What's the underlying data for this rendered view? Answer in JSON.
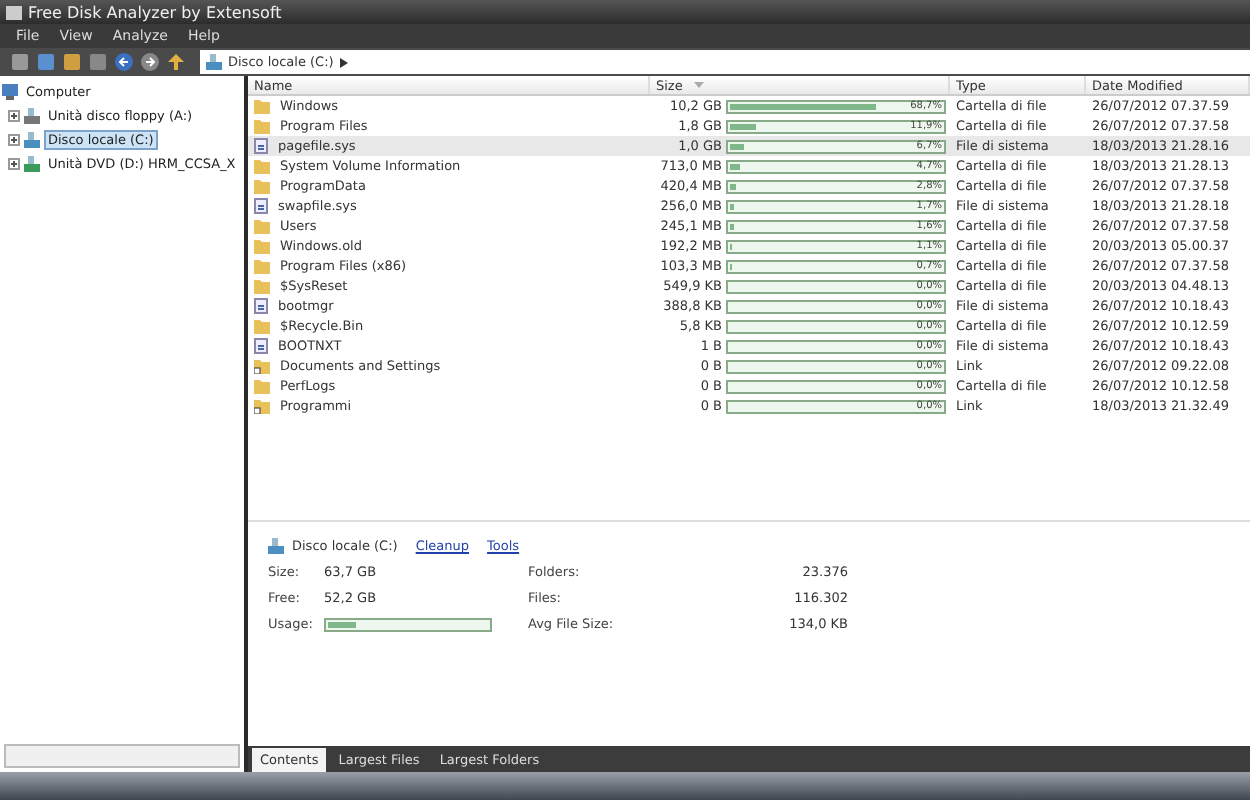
{
  "window": {
    "title": "Free Disk Analyzer by Extensoft"
  },
  "menu": [
    "File",
    "View",
    "Analyze",
    "Help"
  ],
  "address": {
    "location": "Disco locale (C:)"
  },
  "tree": {
    "label": "Computer",
    "children": [
      {
        "label": "Unità disco floppy (A:)",
        "kind": "floppy",
        "selected": false
      },
      {
        "label": "Disco locale (C:)",
        "kind": "disk",
        "selected": true
      },
      {
        "label": "Unità DVD (D:) HRM_CCSA_X",
        "kind": "dvd",
        "selected": false
      }
    ]
  },
  "table": {
    "columns": [
      "Name",
      "Size",
      "Type",
      "Date Modified"
    ],
    "rows": [
      {
        "kind": "folder",
        "name": "Windows",
        "size": "10,2 GB",
        "level": 0.687,
        "percent": "68,7%",
        "type": "Cartella di file",
        "date": "26/07/2012 07.37.59",
        "selected": false
      },
      {
        "kind": "folder",
        "name": "Program Files",
        "size": "1,8 GB",
        "level": 0.119,
        "percent": "11,9%",
        "type": "Cartella di file",
        "date": "26/07/2012 07.37.58",
        "selected": false
      },
      {
        "kind": "file",
        "name": "pagefile.sys",
        "size": "1,0 GB",
        "level": 0.067,
        "percent": "6,7%",
        "type": "File di sistema",
        "date": "18/03/2013 21.28.16",
        "selected": true
      },
      {
        "kind": "folder",
        "name": "System Volume Information",
        "size": "713,0 MB",
        "level": 0.047,
        "percent": "4,7%",
        "type": "Cartella di file",
        "date": "18/03/2013 21.28.13",
        "selected": false
      },
      {
        "kind": "folder",
        "name": "ProgramData",
        "size": "420,4 MB",
        "level": 0.028,
        "percent": "2,8%",
        "type": "Cartella di file",
        "date": "26/07/2012 07.37.58",
        "selected": false
      },
      {
        "kind": "file",
        "name": "swapfile.sys",
        "size": "256,0 MB",
        "level": 0.017,
        "percent": "1,7%",
        "type": "File di sistema",
        "date": "18/03/2013 21.28.18",
        "selected": false
      },
      {
        "kind": "folder",
        "name": "Users",
        "size": "245,1 MB",
        "level": 0.016,
        "percent": "1,6%",
        "type": "Cartella di file",
        "date": "26/07/2012 07.37.58",
        "selected": false
      },
      {
        "kind": "folder",
        "name": "Windows.old",
        "size": "192,2 MB",
        "level": 0.011,
        "percent": "1,1%",
        "type": "Cartella di file",
        "date": "20/03/2013 05.00.37",
        "selected": false
      },
      {
        "kind": "folder",
        "name": "Program Files (x86)",
        "size": "103,3 MB",
        "level": 0.007,
        "percent": "0,7%",
        "type": "Cartella di file",
        "date": "26/07/2012 07.37.58",
        "selected": false
      },
      {
        "kind": "folder",
        "name": "$SysReset",
        "size": "549,9 KB",
        "level": 0,
        "percent": "0,0%",
        "type": "Cartella di file",
        "date": "20/03/2013 04.48.13",
        "selected": false
      },
      {
        "kind": "file",
        "name": "bootmgr",
        "size": "388,8 KB",
        "level": 0,
        "percent": "0,0%",
        "type": "File di sistema",
        "date": "26/07/2012 10.18.43",
        "selected": false
      },
      {
        "kind": "folder",
        "name": "$Recycle.Bin",
        "size": "5,8 KB",
        "level": 0,
        "percent": "0,0%",
        "type": "Cartella di file",
        "date": "26/07/2012 10.12.59",
        "selected": false
      },
      {
        "kind": "file",
        "name": "BOOTNXT",
        "size": "1 B",
        "level": 0,
        "percent": "0,0%",
        "type": "File di sistema",
        "date": "26/07/2012 10.18.43",
        "selected": false
      },
      {
        "kind": "link",
        "name": "Documents and Settings",
        "size": "0 B",
        "level": 0,
        "percent": "0,0%",
        "type": "Link",
        "date": "26/07/2012 09.22.08",
        "selected": false
      },
      {
        "kind": "folder",
        "name": "PerfLogs",
        "size": "0 B",
        "level": 0,
        "percent": "0,0%",
        "type": "Cartella di file",
        "date": "26/07/2012 10.12.58",
        "selected": false
      },
      {
        "kind": "link",
        "name": "Programmi",
        "size": "0 B",
        "level": 0,
        "percent": "0,0%",
        "type": "Link",
        "date": "18/03/2013 21.32.49",
        "selected": false
      }
    ]
  },
  "details": {
    "drive": "Disco locale (C:)",
    "links": [
      "Cleanup",
      "Tools"
    ],
    "left": [
      {
        "label": "Size:",
        "value": "63,7 GB"
      },
      {
        "label": "Free:",
        "value": "52,2 GB"
      },
      {
        "label": "Usage:",
        "kind": "bar",
        "level": 0.18
      }
    ],
    "right": [
      {
        "label": "Folders:",
        "value": "23.376"
      },
      {
        "label": "Files:",
        "value": "116.302"
      },
      {
        "label": "Avg File Size:",
        "value": "134,0  KB"
      }
    ]
  },
  "tabs": [
    {
      "label": "Contents",
      "selected": true
    },
    {
      "label": "Largest Files",
      "selected": false
    },
    {
      "label": "Largest Folders",
      "selected": false
    }
  ]
}
